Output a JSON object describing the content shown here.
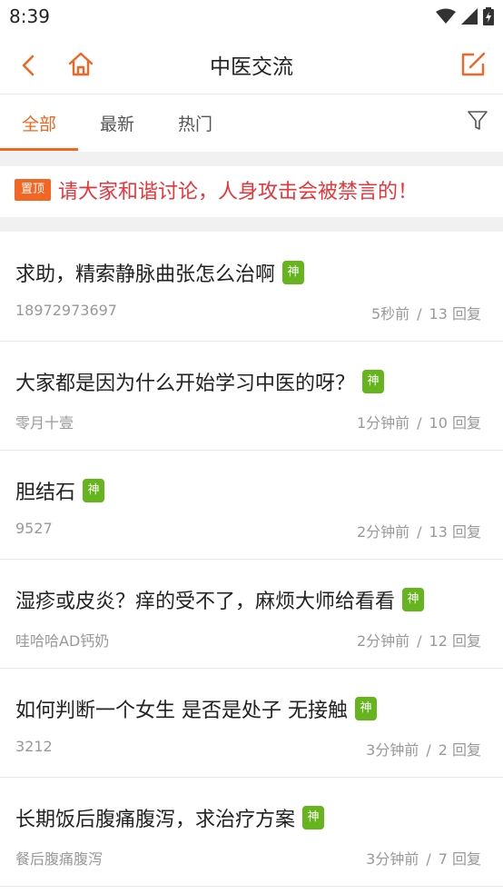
{
  "status": {
    "time": "8:39"
  },
  "nav": {
    "title": "中医交流"
  },
  "tabs": [
    {
      "label": "全部",
      "active": true
    },
    {
      "label": "最新",
      "active": false
    },
    {
      "label": "热门",
      "active": false
    }
  ],
  "pinned": {
    "badge": "置顶",
    "text": "请大家和谐讨论，人身攻击会被禁言的！"
  },
  "posts": [
    {
      "title": "求助，精索静脉曲张怎么治啊",
      "badge": "神",
      "author": "18972973697",
      "time": "5秒前",
      "sep": "/",
      "replies": "13 回复"
    },
    {
      "title": "大家都是因为什么开始学习中医的呀？",
      "badge": "神",
      "author": "零月十壹",
      "time": "1分钟前",
      "sep": "/",
      "replies": "10 回复"
    },
    {
      "title": "胆结石",
      "badge": "神",
      "author": "9527",
      "time": "2分钟前",
      "sep": "/",
      "replies": "13 回复"
    },
    {
      "title": "湿疹或皮炎？痒的受不了，麻烦大师给看看",
      "badge": "神",
      "author": "哇哈哈AD钙奶",
      "time": "2分钟前",
      "sep": "/",
      "replies": "12 回复"
    },
    {
      "title": "如何判断一个女生 是否是处子 无接触",
      "badge": "神",
      "author": "3212",
      "time": "3分钟前",
      "sep": "/",
      "replies": "2 回复"
    },
    {
      "title": "长期饭后腹痛腹泻，求治疗方案",
      "badge": "神",
      "author": "餐后腹痛腹泻",
      "time": "3分钟前",
      "sep": "/",
      "replies": "7 回复"
    }
  ],
  "colors": {
    "accent": "#f26522",
    "pinned_text": "#e8353a",
    "badge_green": "#66b51f"
  }
}
